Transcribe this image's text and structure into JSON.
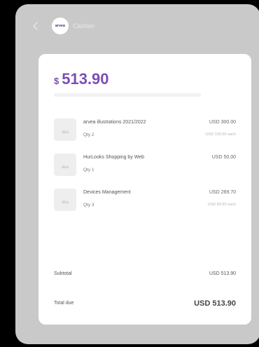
{
  "header": {
    "logo_text": "arvea",
    "title": "Cashier"
  },
  "summary": {
    "currency_symbol": "$",
    "amount": "513.90"
  },
  "items": [
    {
      "name": "arvea illustrations 2021/2022",
      "qty": "Qty 2",
      "price": "USD 300.00",
      "unit": "USD 150.00 each"
    },
    {
      "name": "HurLooks Shopping by Web",
      "qty": "Qty 1",
      "price": "USD 50.00",
      "unit": ""
    },
    {
      "name": "Devices Management",
      "qty": "Qty 3",
      "price": "USD 269.70",
      "unit": "USD 89.90 each"
    }
  ],
  "totals": {
    "subtotal_label": "Subtotal",
    "subtotal_value": "USD 513.90",
    "total_label": "Total due",
    "total_value": "USD 513.90"
  },
  "colors": {
    "accent": "#7b4fb5",
    "device_bg": "#c9c9c9",
    "card_bg": "#ffffff"
  }
}
